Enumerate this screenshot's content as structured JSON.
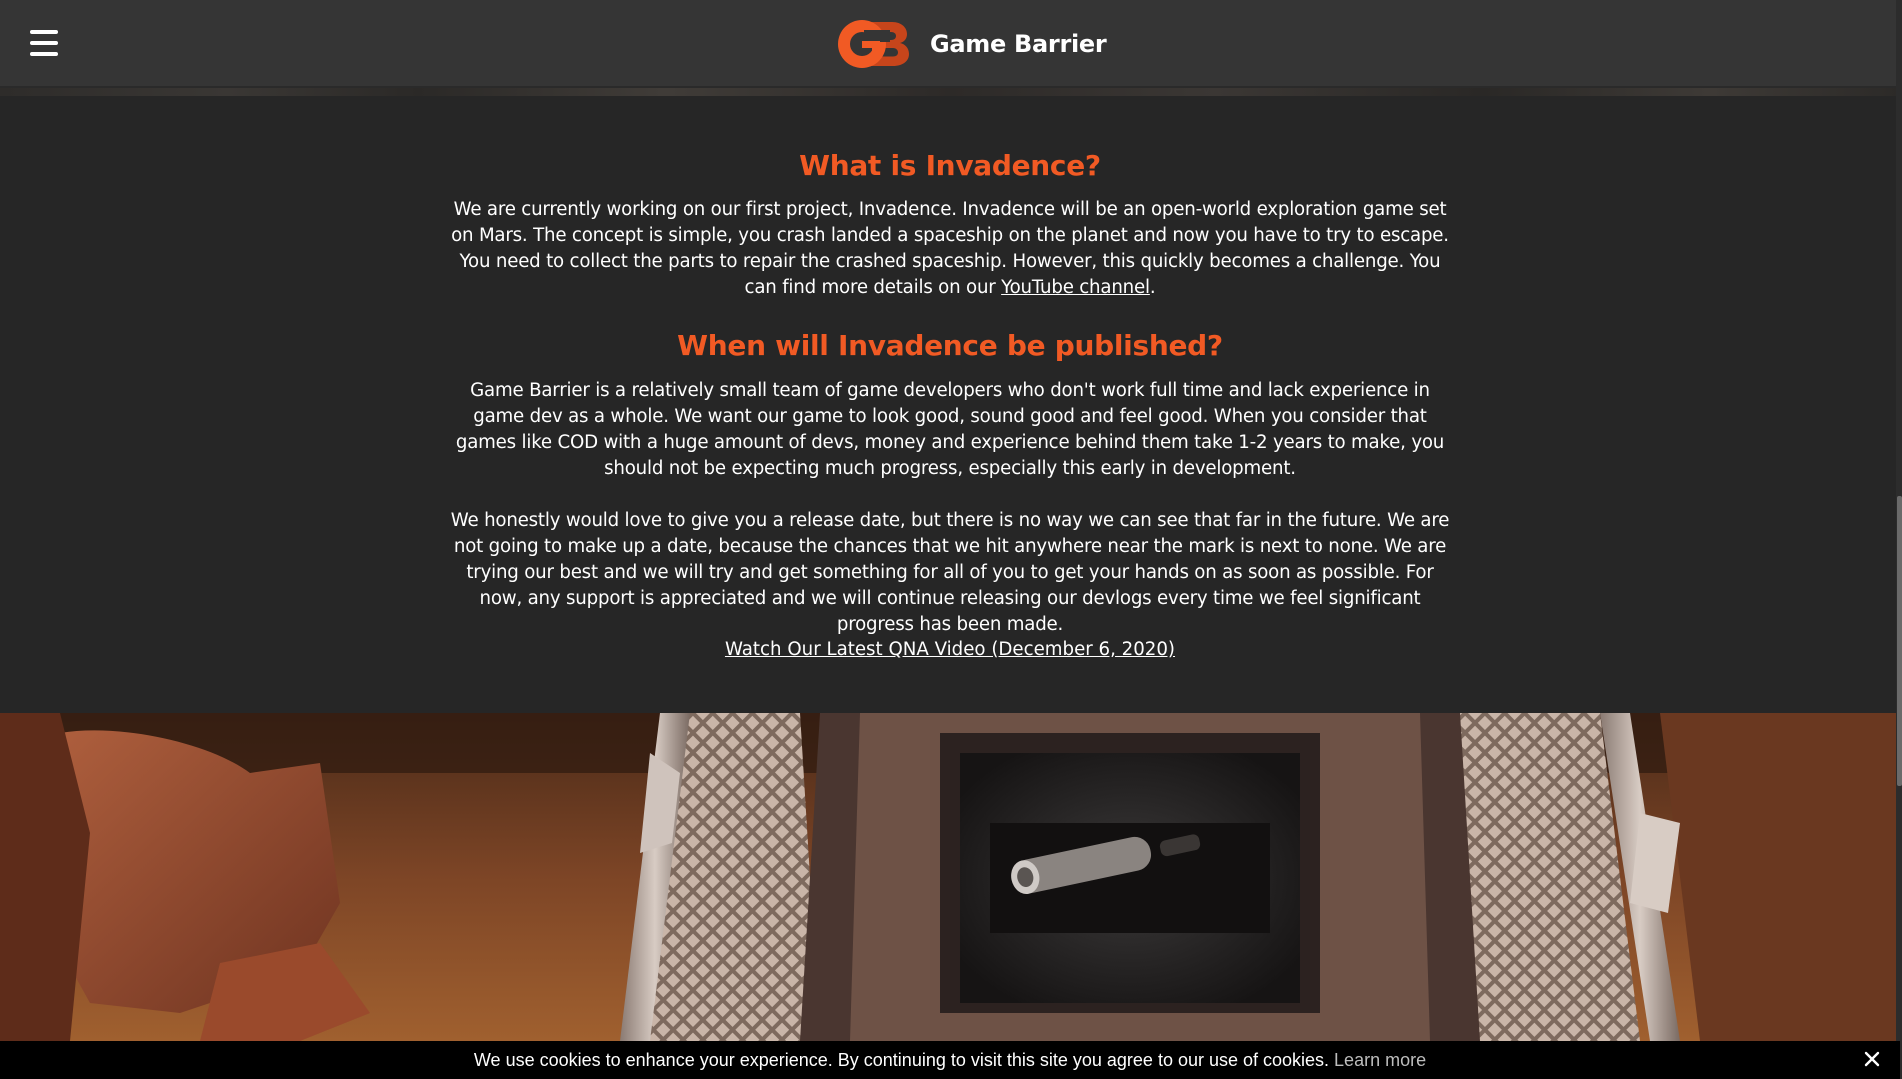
{
  "header": {
    "menu_icon": "hamburger-menu-icon",
    "logo_icon": "gb-logo",
    "brand_name": "Game Barrier"
  },
  "content": {
    "section1": {
      "heading": "What is Invadence?",
      "text_before_link": "We are currently working on our first project, Invadence. Invadence will be an open-world exploration game set on Mars. The concept is simple, you crash landed a spaceship on the planet and now you have to try to escape. You need to collect the parts to repair the crashed spaceship. However, this quickly becomes a challenge. You can find more details on our ",
      "link_text": "YouTube channel",
      "text_after_link": "."
    },
    "section2": {
      "heading": "When will Invadence be published?",
      "paragraph1": "Game Barrier is a relatively small team of game developers who don't work full time and lack experience in game dev as a whole. We want our game to look good, sound good and feel good. When you consider that games like COD with a huge amount of devs, money and experience behind them take 1-2 years to make, you should not be expecting much progress, especially this early in development.",
      "paragraph2": "We honestly would love to give you a release date, but there is no way we can see that far in the future. We are not going to make up a date, because the chances that we hit anywhere near the mark is next to none. We are trying our best and we will try and get something for all of you to get your hands on as soon as possible. For now, any support is appreciated and we will continue releasing our devlogs every time we feel significant progress has been made."
    },
    "qna_link": "Watch Our Latest QNA Video (December 6, 2020)"
  },
  "cookie_bar": {
    "message": "We use cookies to enhance your experience. By continuing to visit this site you agree to our use of cookies. ",
    "learn_more": "Learn more",
    "close_icon": "close-icon"
  },
  "colors": {
    "accent": "#f15a24",
    "header_bg": "#353535",
    "page_bg": "#262626",
    "cookie_bg": "#000000"
  }
}
